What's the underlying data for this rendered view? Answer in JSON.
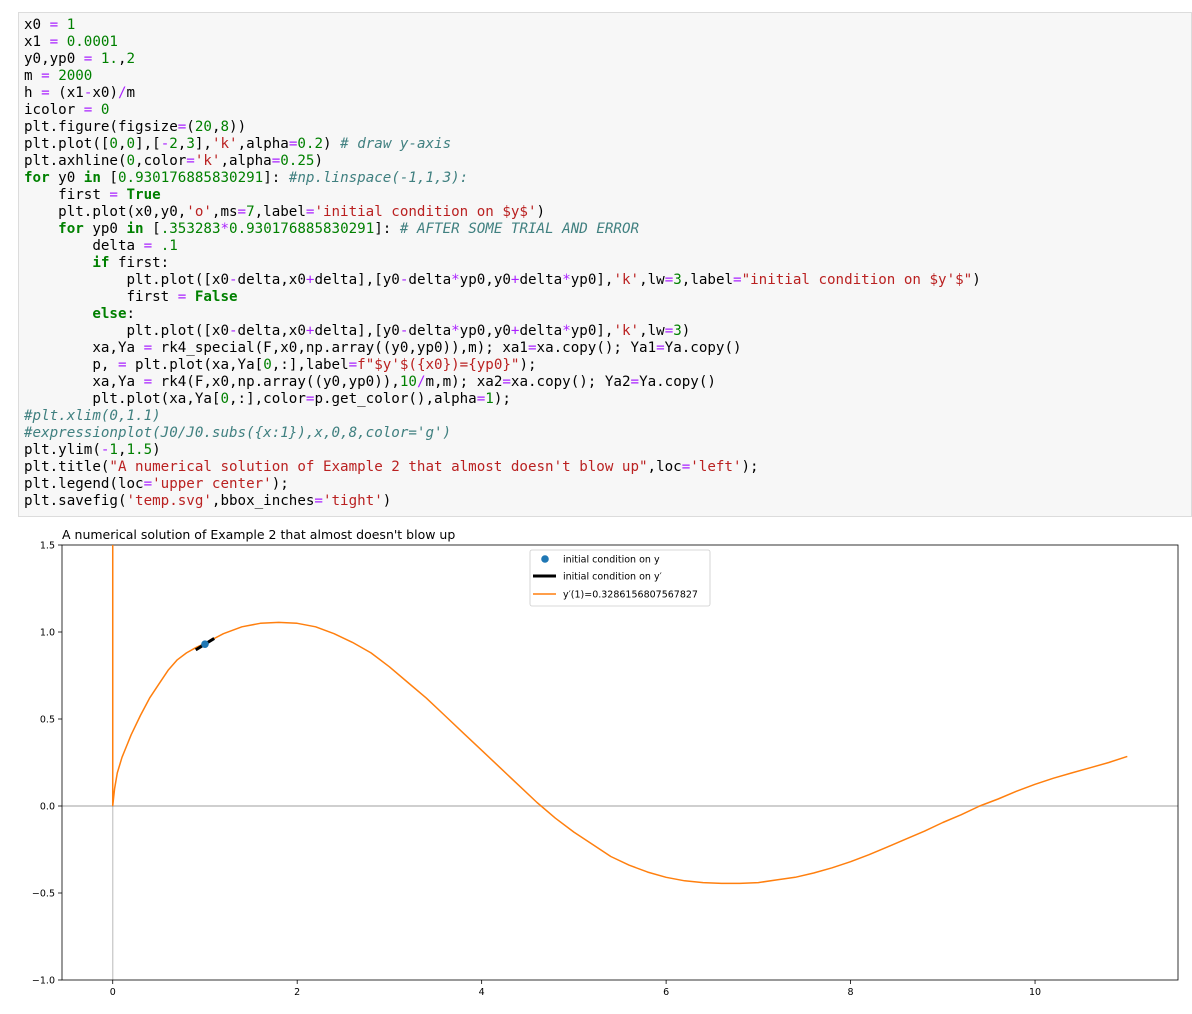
{
  "code": {
    "lines": [
      [
        [
          "v",
          "x0 "
        ],
        [
          "op",
          "="
        ],
        [
          "v",
          " "
        ],
        [
          "num",
          "1"
        ]
      ],
      [
        [
          "v",
          "x1 "
        ],
        [
          "op",
          "="
        ],
        [
          "v",
          " "
        ],
        [
          "num",
          "0.0001"
        ]
      ],
      [
        [
          "v",
          "y0,yp0 "
        ],
        [
          "op",
          "="
        ],
        [
          "v",
          " "
        ],
        [
          "num",
          "1."
        ],
        [
          "v",
          ","
        ],
        [
          "num",
          "2"
        ]
      ],
      [
        [
          "v",
          "m "
        ],
        [
          "op",
          "="
        ],
        [
          "v",
          " "
        ],
        [
          "num",
          "2000"
        ]
      ],
      [
        [
          "v",
          "h "
        ],
        [
          "op",
          "="
        ],
        [
          "v",
          " (x1"
        ],
        [
          "op",
          "-"
        ],
        [
          "v",
          "x0)"
        ],
        [
          "op",
          "/"
        ],
        [
          "v",
          "m"
        ]
      ],
      [
        [
          "v",
          "icolor "
        ],
        [
          "op",
          "="
        ],
        [
          "v",
          " "
        ],
        [
          "num",
          "0"
        ]
      ],
      [
        [
          "v",
          "plt.figure(figsize"
        ],
        [
          "op",
          "="
        ],
        [
          "v",
          "("
        ],
        [
          "num",
          "20"
        ],
        [
          "v",
          ","
        ],
        [
          "num",
          "8"
        ],
        [
          "v",
          "))"
        ]
      ],
      [
        [
          "v",
          "plt.plot(["
        ],
        [
          "num",
          "0"
        ],
        [
          "v",
          ","
        ],
        [
          "num",
          "0"
        ],
        [
          "v",
          "],["
        ],
        [
          "op",
          "-"
        ],
        [
          "num",
          "2"
        ],
        [
          "v",
          ","
        ],
        [
          "num",
          "3"
        ],
        [
          "v",
          "],"
        ],
        [
          "str",
          "'k'"
        ],
        [
          "v",
          ",alpha"
        ],
        [
          "op",
          "="
        ],
        [
          "num",
          "0.2"
        ],
        [
          "v",
          ") "
        ],
        [
          "cm",
          "# draw y-axis"
        ]
      ],
      [
        [
          "v",
          "plt.axhline("
        ],
        [
          "num",
          "0"
        ],
        [
          "v",
          ",color"
        ],
        [
          "op",
          "="
        ],
        [
          "str",
          "'k'"
        ],
        [
          "v",
          ",alpha"
        ],
        [
          "op",
          "="
        ],
        [
          "num",
          "0.25"
        ],
        [
          "v",
          ")"
        ]
      ],
      [
        [
          "kw",
          "for"
        ],
        [
          "v",
          " y0 "
        ],
        [
          "kw",
          "in"
        ],
        [
          "v",
          " ["
        ],
        [
          "num",
          "0.930176885830291"
        ],
        [
          "v",
          "]: "
        ],
        [
          "cm",
          "#np.linspace(-1,1,3):"
        ]
      ],
      [
        [
          "v",
          "    first "
        ],
        [
          "op",
          "="
        ],
        [
          "v",
          " "
        ],
        [
          "kw",
          "True"
        ]
      ],
      [
        [
          "v",
          "    plt.plot(x0,y0,"
        ],
        [
          "str",
          "'o'"
        ],
        [
          "v",
          ",ms"
        ],
        [
          "op",
          "="
        ],
        [
          "num",
          "7"
        ],
        [
          "v",
          ",label"
        ],
        [
          "op",
          "="
        ],
        [
          "str",
          "'initial condition on $y$'"
        ],
        [
          "v",
          ")"
        ]
      ],
      [
        [
          "v",
          "    "
        ],
        [
          "kw",
          "for"
        ],
        [
          "v",
          " yp0 "
        ],
        [
          "kw",
          "in"
        ],
        [
          "v",
          " ["
        ],
        [
          "num",
          ".353283"
        ],
        [
          "op",
          "*"
        ],
        [
          "num",
          "0.930176885830291"
        ],
        [
          "v",
          "]: "
        ],
        [
          "cm",
          "# AFTER SOME TRIAL AND ERROR"
        ]
      ],
      [
        [
          "v",
          "        delta "
        ],
        [
          "op",
          "="
        ],
        [
          "v",
          " "
        ],
        [
          "num",
          ".1"
        ]
      ],
      [
        [
          "v",
          "        "
        ],
        [
          "kw",
          "if"
        ],
        [
          "v",
          " first:"
        ]
      ],
      [
        [
          "v",
          "            plt.plot([x0"
        ],
        [
          "op",
          "-"
        ],
        [
          "v",
          "delta,x0"
        ],
        [
          "op",
          "+"
        ],
        [
          "v",
          "delta],[y0"
        ],
        [
          "op",
          "-"
        ],
        [
          "v",
          "delta"
        ],
        [
          "op",
          "*"
        ],
        [
          "v",
          "yp0,y0"
        ],
        [
          "op",
          "+"
        ],
        [
          "v",
          "delta"
        ],
        [
          "op",
          "*"
        ],
        [
          "v",
          "yp0],"
        ],
        [
          "str",
          "'k'"
        ],
        [
          "v",
          ",lw"
        ],
        [
          "op",
          "="
        ],
        [
          "num",
          "3"
        ],
        [
          "v",
          ",label"
        ],
        [
          "op",
          "="
        ],
        [
          "str",
          "\"initial condition on $y'$\""
        ],
        [
          "v",
          ")"
        ]
      ],
      [
        [
          "v",
          "            first "
        ],
        [
          "op",
          "="
        ],
        [
          "v",
          " "
        ],
        [
          "kw",
          "False"
        ]
      ],
      [
        [
          "v",
          "        "
        ],
        [
          "kw",
          "else"
        ],
        [
          "v",
          ":"
        ]
      ],
      [
        [
          "v",
          "            plt.plot([x0"
        ],
        [
          "op",
          "-"
        ],
        [
          "v",
          "delta,x0"
        ],
        [
          "op",
          "+"
        ],
        [
          "v",
          "delta],[y0"
        ],
        [
          "op",
          "-"
        ],
        [
          "v",
          "delta"
        ],
        [
          "op",
          "*"
        ],
        [
          "v",
          "yp0,y0"
        ],
        [
          "op",
          "+"
        ],
        [
          "v",
          "delta"
        ],
        [
          "op",
          "*"
        ],
        [
          "v",
          "yp0],"
        ],
        [
          "str",
          "'k'"
        ],
        [
          "v",
          ",lw"
        ],
        [
          "op",
          "="
        ],
        [
          "num",
          "3"
        ],
        [
          "v",
          ")"
        ]
      ],
      [
        [
          "v",
          "        xa,Ya "
        ],
        [
          "op",
          "="
        ],
        [
          "v",
          " rk4_special(F,x0,np.array((y0,yp0)),m); xa1"
        ],
        [
          "op",
          "="
        ],
        [
          "v",
          "xa.copy(); Ya1"
        ],
        [
          "op",
          "="
        ],
        [
          "v",
          "Ya.copy()"
        ]
      ],
      [
        [
          "v",
          "        p, "
        ],
        [
          "op",
          "="
        ],
        [
          "v",
          " plt.plot(xa,Ya["
        ],
        [
          "num",
          "0"
        ],
        [
          "v",
          ",:],label"
        ],
        [
          "op",
          "="
        ],
        [
          "str",
          "f\"$y'$({x0})={yp0}\""
        ],
        [
          "v",
          ");"
        ]
      ],
      [
        [
          "v",
          "        xa,Ya "
        ],
        [
          "op",
          "="
        ],
        [
          "v",
          " rk4(F,x0,np.array((y0,yp0)),"
        ],
        [
          "num",
          "10"
        ],
        [
          "op",
          "/"
        ],
        [
          "v",
          "m,m); xa2"
        ],
        [
          "op",
          "="
        ],
        [
          "v",
          "xa.copy(); Ya2"
        ],
        [
          "op",
          "="
        ],
        [
          "v",
          "Ya.copy()"
        ]
      ],
      [
        [
          "v",
          "        plt.plot(xa,Ya["
        ],
        [
          "num",
          "0"
        ],
        [
          "v",
          ",:],color"
        ],
        [
          "op",
          "="
        ],
        [
          "v",
          "p.get_color(),alpha"
        ],
        [
          "op",
          "="
        ],
        [
          "num",
          "1"
        ],
        [
          "v",
          ");"
        ]
      ],
      [
        [
          "cm",
          "#plt.xlim(0,1.1)"
        ]
      ],
      [
        [
          "cm",
          "#expressionplot(J0/J0.subs({x:1}),x,0,8,color='g')"
        ]
      ],
      [
        [
          "v",
          "plt.ylim("
        ],
        [
          "op",
          "-"
        ],
        [
          "num",
          "1"
        ],
        [
          "v",
          ","
        ],
        [
          "num",
          "1.5"
        ],
        [
          "v",
          ")"
        ]
      ],
      [
        [
          "v",
          "plt.title("
        ],
        [
          "str",
          "\"A numerical solution of Example 2 that almost doesn't blow up\""
        ],
        [
          "v",
          ",loc"
        ],
        [
          "op",
          "="
        ],
        [
          "str",
          "'left'"
        ],
        [
          "v",
          ");"
        ]
      ],
      [
        [
          "v",
          "plt.legend(loc"
        ],
        [
          "op",
          "="
        ],
        [
          "str",
          "'upper center'"
        ],
        [
          "v",
          ");"
        ]
      ],
      [
        [
          "v",
          "plt.savefig("
        ],
        [
          "str",
          "'temp.svg'"
        ],
        [
          "v",
          ",bbox_inches"
        ],
        [
          "op",
          "="
        ],
        [
          "str",
          "'tight'"
        ],
        [
          "v",
          ")"
        ]
      ]
    ]
  },
  "chart_data": {
    "type": "line",
    "title": "A numerical solution of Example 2 that almost doesn't blow up",
    "xlim": [
      -0.55,
      11.55
    ],
    "ylim": [
      -1,
      1.5
    ],
    "xticks": [
      0,
      2,
      4,
      6,
      8,
      10
    ],
    "xtick_labels": [
      "0",
      "2",
      "4",
      "6",
      "8",
      "10"
    ],
    "yticks": [
      -1,
      -0.5,
      0,
      0.5,
      1,
      1.5
    ],
    "ytick_labels": [
      "−1.0",
      "−0.5",
      "0.0",
      "0.5",
      "1.0",
      "1.5"
    ],
    "legend_position": "upper center",
    "legend": {
      "point": "initial condition on y",
      "segment": "initial condition on y′",
      "curve": "y′(1)=0.3286156807567827"
    },
    "initial_point": {
      "x": 1,
      "y": 0.930176885830291
    },
    "slope_segment": {
      "x": [
        0.9,
        1.1
      ],
      "y": [
        0.8973,
        0.963
      ]
    },
    "yaxis_line": {
      "x": [
        0,
        0
      ],
      "y": [
        -2,
        3
      ]
    },
    "hline_y": 0,
    "near_zero_branch": {
      "x": [
        0.0001,
        0.0001
      ],
      "y": [
        0,
        1.5
      ]
    },
    "curve": {
      "x": [
        0.0,
        0.02,
        0.05,
        0.1,
        0.2,
        0.3,
        0.4,
        0.5,
        0.6,
        0.7,
        0.8,
        0.9,
        1.0,
        1.2,
        1.4,
        1.6,
        1.8,
        2.0,
        2.2,
        2.4,
        2.6,
        2.8,
        3.0,
        3.2,
        3.4,
        3.6,
        3.8,
        4.0,
        4.2,
        4.4,
        4.6,
        4.8,
        5.0,
        5.2,
        5.4,
        5.6,
        5.8,
        6.0,
        6.2,
        6.4,
        6.6,
        6.8,
        7.0,
        7.2,
        7.4,
        7.6,
        7.8,
        8.0,
        8.2,
        8.4,
        8.6,
        8.8,
        9.0,
        9.2,
        9.4,
        9.6,
        9.8,
        10.0,
        10.2,
        10.4,
        10.6,
        10.8,
        11.0
      ],
      "y": [
        0.0,
        0.1,
        0.19,
        0.28,
        0.41,
        0.52,
        0.62,
        0.7,
        0.78,
        0.84,
        0.88,
        0.91,
        0.935,
        0.99,
        1.03,
        1.05,
        1.055,
        1.05,
        1.03,
        0.99,
        0.94,
        0.88,
        0.8,
        0.71,
        0.62,
        0.52,
        0.42,
        0.32,
        0.22,
        0.12,
        0.02,
        -0.07,
        -0.15,
        -0.22,
        -0.29,
        -0.34,
        -0.38,
        -0.41,
        -0.43,
        -0.44,
        -0.445,
        -0.445,
        -0.44,
        -0.425,
        -0.41,
        -0.385,
        -0.355,
        -0.32,
        -0.28,
        -0.235,
        -0.19,
        -0.145,
        -0.095,
        -0.05,
        0.0,
        0.04,
        0.085,
        0.125,
        0.16,
        0.19,
        0.22,
        0.25,
        0.285
      ]
    },
    "colors": {
      "point": "#1f77b4",
      "segment": "#000000",
      "curve": "#ff7f0e"
    }
  }
}
